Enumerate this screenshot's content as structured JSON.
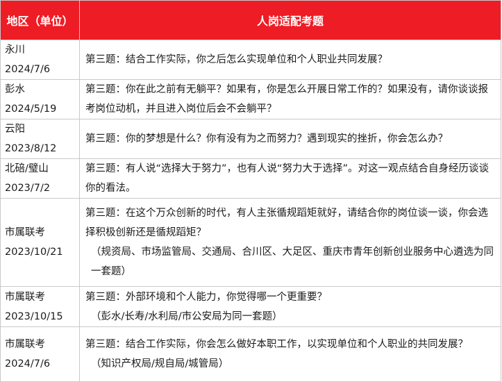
{
  "header": {
    "region_col": "地区（单位）",
    "topic_col": "人岗适配考题"
  },
  "rows": [
    {
      "region": "永川",
      "date": "2024/7/6",
      "question": "第三题：结合工作实际，你之后怎么实现单位和个人职业共同发展？",
      "note": ""
    },
    {
      "region": "彭水",
      "date": "2024/5/19",
      "question": "第三题：你在此之前有无躺平？如果有，你是怎么开展日常工作的？如果没有，请你谈谈报考岗位动机，并且进入岗位后会不会躺平？",
      "note": ""
    },
    {
      "region": "云阳",
      "date": "2023/8/12",
      "question": "第三题：你的梦想是什么？你有没有为之而努力？遇到现实的挫折，你会怎么办？",
      "note": ""
    },
    {
      "region": "北碚/璧山",
      "date": "2023/7/2",
      "question": "第三题：有人说“选择大于努力”，也有人说“努力大于选择”。对这一观点结合自身经历谈谈你的看法。",
      "note": ""
    },
    {
      "region": "市属联考",
      "date": "2023/10/21",
      "question": "第三题：在这个万众创新的时代，有人主张循规蹈矩就好，请结合你的岗位谈一谈，你会选择积极创新还是循规蹈矩？",
      "note": "（规资局、市场监管局、交通局、合川区、大足区、重庆市青年创新创业服务中心遴选为同一套题）"
    },
    {
      "region": "市属联考",
      "date": "2023/10/15",
      "question": "第三题：外部环境和个人能力，你觉得哪一个更重要？",
      "note": "（彭水/长寿/水利局/市公安局为同一套题）"
    },
    {
      "region": "市属联考",
      "date": "2024/7/6",
      "question": "第三题：结合工作实际，你会怎么做好本职工作，以实现单位和个人职业的共同发展？",
      "note": "（知识产权局/规自局/城管局）"
    }
  ]
}
